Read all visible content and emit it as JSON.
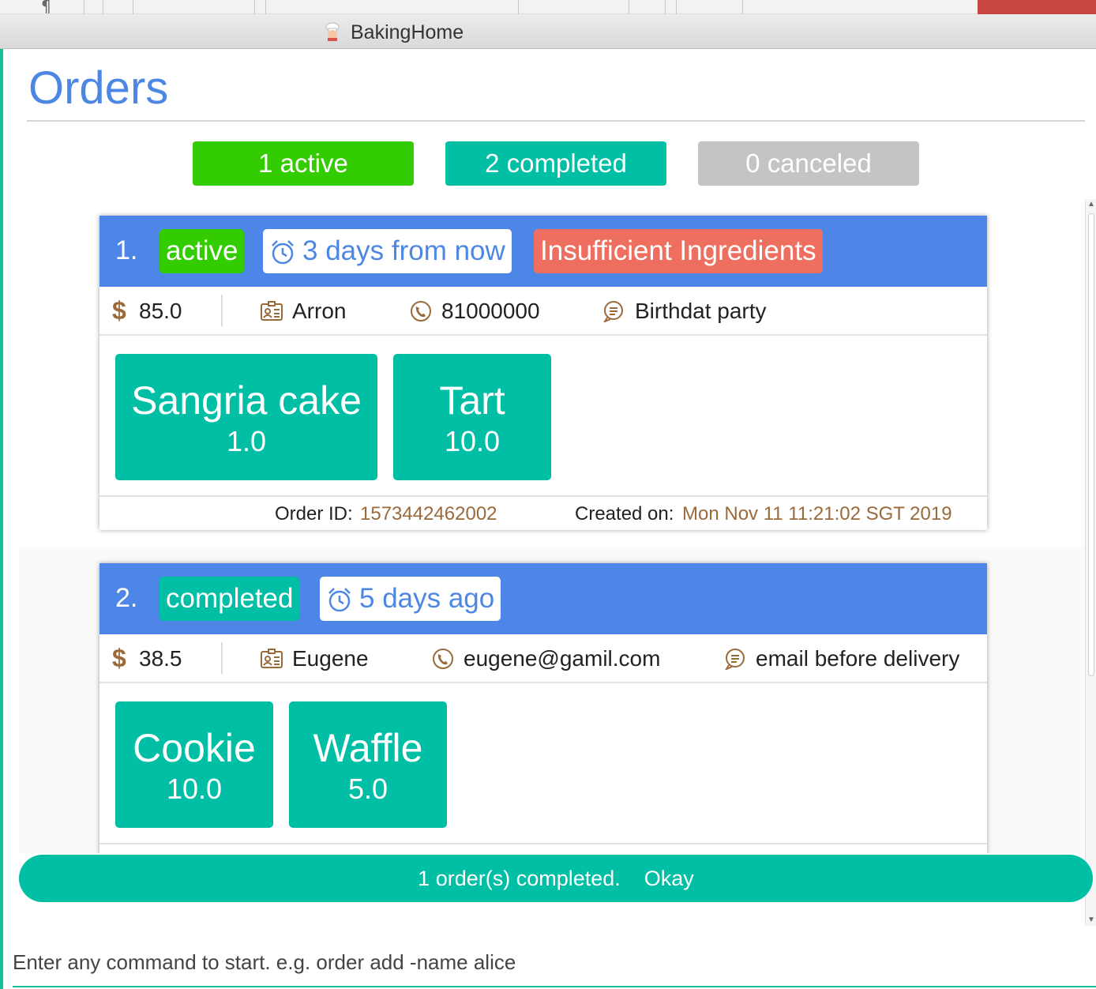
{
  "window": {
    "title": "BakingHome",
    "app_icon": "chef-icon"
  },
  "page": {
    "title": "Orders"
  },
  "stats": {
    "active_label": "1 active",
    "completed_label": "2 completed",
    "canceled_label": "0 canceled"
  },
  "orders": [
    {
      "index": "1.",
      "status": "active",
      "time": "3 days from now",
      "warning": "Insufficient Ingredients",
      "currency_symbol": "$",
      "price": "85.0",
      "customer": "Arron",
      "contact": "81000000",
      "remark": "Birthdat party",
      "items": [
        {
          "name": "Sangria cake",
          "qty": "1.0"
        },
        {
          "name": "Tart",
          "qty": "10.0"
        }
      ],
      "order_id_label": "Order ID:",
      "order_id": "1573442462002",
      "created_label": "Created on:",
      "created": "Mon Nov 11 11:21:02 SGT 2019"
    },
    {
      "index": "2.",
      "status": "completed",
      "time": "5 days ago",
      "currency_symbol": "$",
      "price": "38.5",
      "customer": "Eugene",
      "contact": "eugene@gamil.com",
      "remark": "email before delivery",
      "items": [
        {
          "name": "Cookie",
          "qty": "10.0"
        },
        {
          "name": "Waffle",
          "qty": "5.0"
        }
      ]
    }
  ],
  "toast": {
    "message": "1 order(s) completed.",
    "action": "Okay"
  },
  "command_box": {
    "placeholder": "Enter any command to start. e.g. order add -name alice"
  },
  "colors": {
    "title_blue": "#4d87e4",
    "header_blue": "#4e86e8",
    "active_green": "#33cc00",
    "teal": "#00bfa5",
    "canceled_grey": "#c4c4c4",
    "warning_red": "#ee6e60",
    "detail_brown": "#9a6a3a"
  }
}
